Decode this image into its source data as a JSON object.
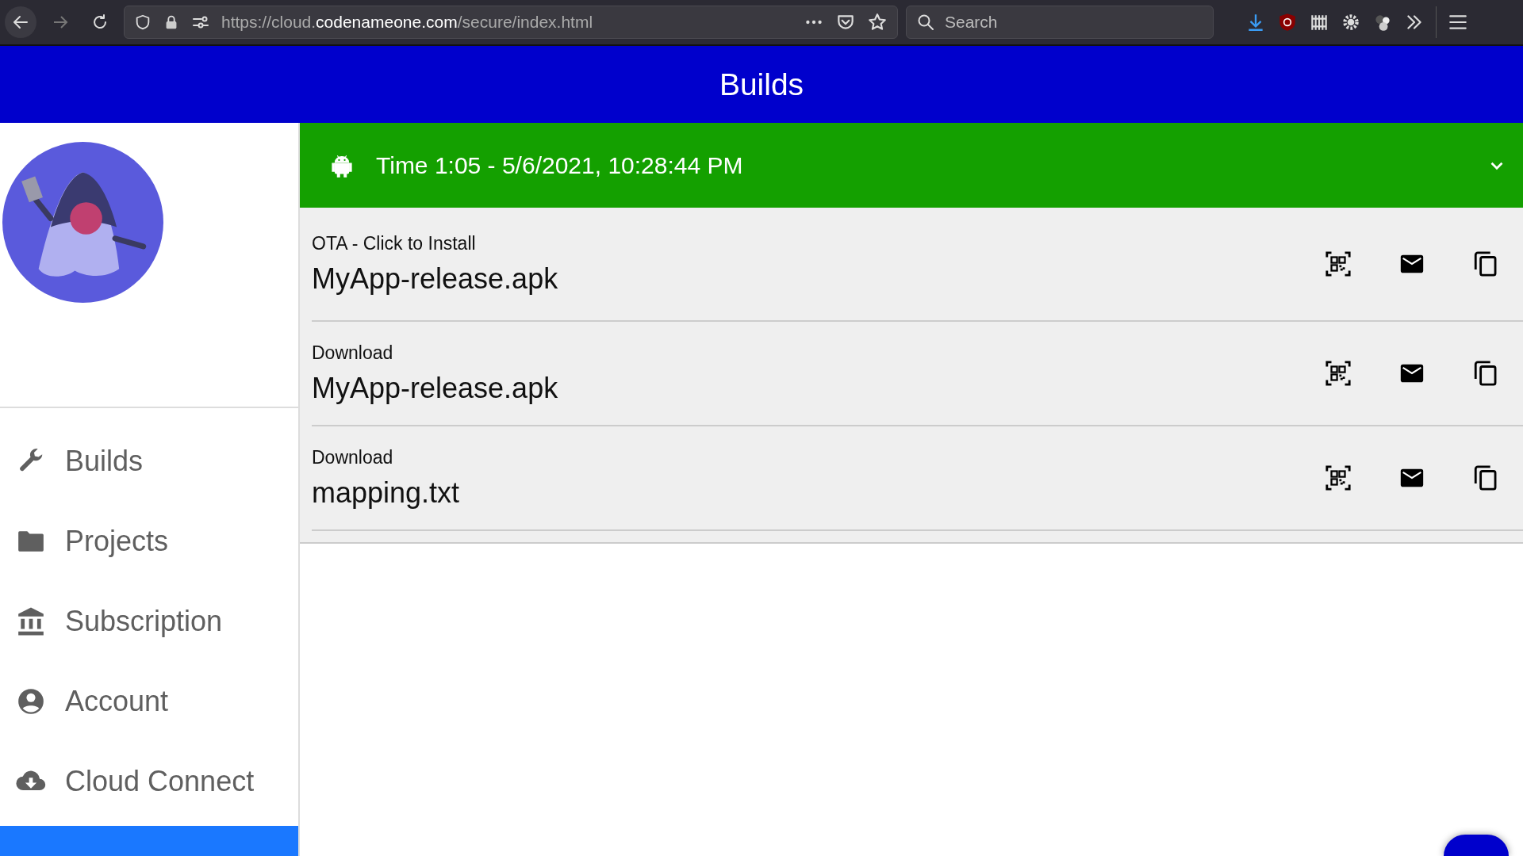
{
  "browser": {
    "url": {
      "host_prefix": "https://cloud.",
      "domain": "codenameone.com",
      "path": "/secure/index.html"
    },
    "search": {
      "placeholder": "Search"
    }
  },
  "header": {
    "title": "Builds"
  },
  "sidebar": {
    "items": [
      {
        "label": "Builds",
        "kind": "wrench"
      },
      {
        "label": "Projects",
        "kind": "folder"
      },
      {
        "label": "Subscription",
        "kind": "bank"
      },
      {
        "label": "Account",
        "kind": "person"
      },
      {
        "label": "Cloud Connect",
        "kind": "cloud"
      }
    ]
  },
  "build": {
    "kind": "android",
    "title": "Time 1:05 - 5/6/2021, 10:28:44 PM",
    "expanded": true,
    "files": [
      {
        "action": "OTA - Click to Install",
        "name": "MyApp-release.apk"
      },
      {
        "action": "Download",
        "name": "MyApp-release.apk"
      },
      {
        "action": "Download",
        "name": "mapping.txt"
      }
    ]
  }
}
